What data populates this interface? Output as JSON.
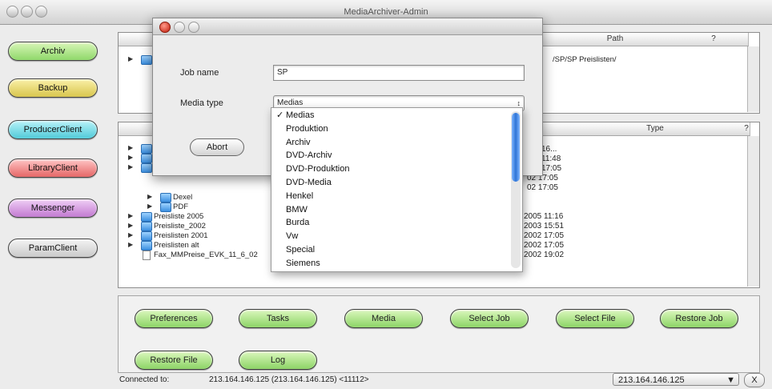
{
  "window": {
    "title": "MediaArchiver-Admin"
  },
  "left_buttons": [
    {
      "label": "Archiv",
      "color": "g"
    },
    {
      "label": "Backup",
      "color": "y"
    },
    {
      "label": "ProducerClient",
      "color": "c"
    },
    {
      "label": "LibraryClient",
      "color": "r"
    },
    {
      "label": "Messenger",
      "color": "p"
    },
    {
      "label": "ParamClient",
      "color": "s"
    }
  ],
  "top_pane": {
    "headers": {
      "path": "Path",
      "q": "?"
    },
    "path_value": "/SP/SP Preislisten/"
  },
  "file_pane": {
    "headers": {
      "type": "Type",
      "q": "?"
    },
    "rows": [
      {
        "name": "Dexel",
        "date": ""
      },
      {
        "name": "PDF",
        "date": ""
      },
      {
        "name": "Preisliste 2005",
        "date": "2005  11:16"
      },
      {
        "name": "Preisliste_2002",
        "date": "2003  15:51"
      },
      {
        "name": "Preislisten 2001",
        "date": "2002  17:05"
      },
      {
        "name": "Preislisten alt",
        "date": "2002  17:05"
      },
      {
        "name": "Fax_MMPreise_EVK_11_6_02",
        "date": "2002  19:02"
      }
    ],
    "upper_dates": [
      "16...",
      "11:48",
      "17:05",
      "02  17:05",
      "02  17:05"
    ]
  },
  "dialog": {
    "job_name_label": "Job name",
    "job_name_value": "SP",
    "media_type_label": "Media type",
    "media_type_value": "Medias",
    "abort_label": "Abort"
  },
  "media_menu": {
    "selected": "Medias",
    "options": [
      "Medias",
      "Produktion",
      "Archiv",
      "DVD-Archiv",
      "DVD-Produktion",
      "DVD-Media",
      "Henkel",
      "BMW",
      "Burda",
      "Vw",
      "Special",
      "Siemens"
    ]
  },
  "actions": {
    "row1": [
      "Preferences",
      "Tasks",
      "Media",
      "Select Job",
      "Select File",
      "Restore Job"
    ],
    "row2": [
      "Restore File",
      "Log"
    ]
  },
  "status": {
    "connected_label": "Connected to:",
    "connected_value": "213.164.146.125 (213.164.146.125) <11112>",
    "server_select": "213.164.146.125",
    "close_symbol": "X"
  }
}
